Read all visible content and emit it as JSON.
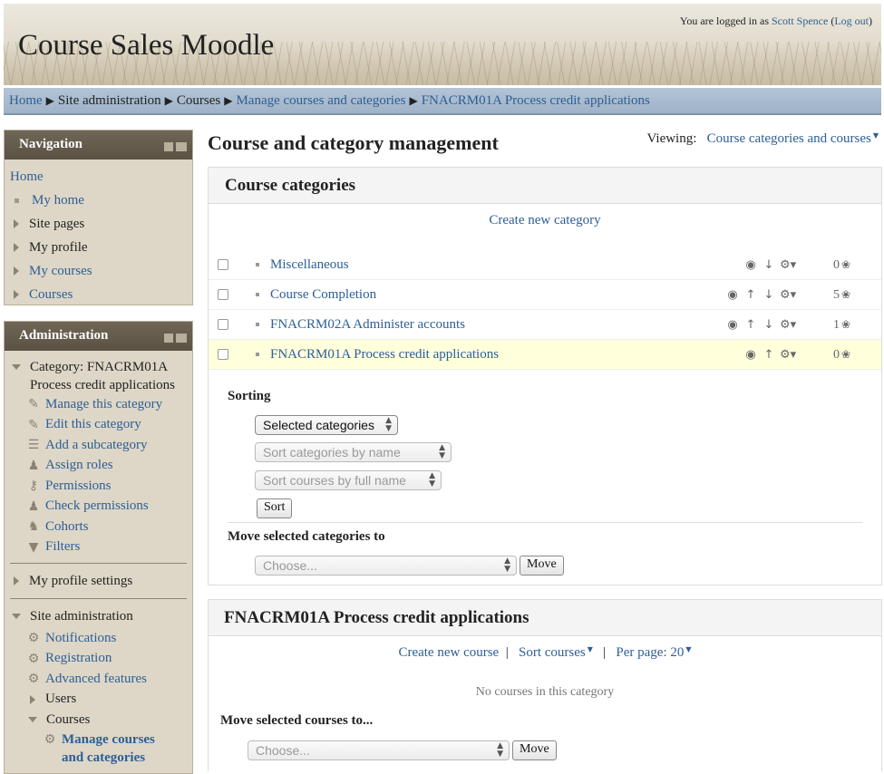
{
  "header": {
    "site_title": "Course Sales Moodle",
    "login_prefix": "You are logged in as",
    "user_name": "Scott Spence",
    "logout": "Log out"
  },
  "breadcrumb": [
    "Home",
    "Site administration",
    "Courses",
    "Manage courses and categories",
    "FNACRM01A Process credit applications"
  ],
  "navigation": {
    "title": "Navigation",
    "home": "Home",
    "items": [
      "My home",
      "Site pages",
      "My profile",
      "My courses",
      "Courses"
    ]
  },
  "administration": {
    "title": "Administration",
    "category_label": "Category: FNACRM01A Process credit applications",
    "category_items": [
      "Manage this category",
      "Edit this category",
      "Add a subcategory",
      "Assign roles",
      "Permissions",
      "Check permissions",
      "Cohorts",
      "Filters"
    ],
    "profile_settings": "My profile settings",
    "site_admin": "Site administration",
    "site_admin_items": [
      "Notifications",
      "Registration",
      "Advanced features"
    ],
    "users": "Users",
    "courses": "Courses",
    "manage": "Manage courses and categories"
  },
  "main": {
    "title": "Course and category management",
    "viewing_label": "Viewing:",
    "viewing_value": "Course categories and courses"
  },
  "categories_panel": {
    "title": "Course categories",
    "create_link": "Create new category",
    "rows": [
      {
        "name": "Miscellaneous",
        "count": "0"
      },
      {
        "name": "Course Completion",
        "count": "5"
      },
      {
        "name": "FNACRM02A Administer accounts",
        "count": "1"
      },
      {
        "name": "FNACRM01A Process credit applications",
        "count": "0"
      }
    ],
    "sorting_label": "Sorting",
    "sort_scope": "Selected categories",
    "sort_categories": "Sort categories by name",
    "sort_courses": "Sort courses by full name",
    "sort_button": "Sort",
    "move_label": "Move selected categories to",
    "move_placeholder": "Choose...",
    "move_button": "Move"
  },
  "courses_panel": {
    "title": "FNACRM01A Process credit applications",
    "create_course": "Create new course",
    "sort_courses": "Sort courses",
    "per_page": "Per page: 20",
    "empty": "No courses in this category",
    "move_label": "Move selected courses to...",
    "move_placeholder": "Choose...",
    "move_button": "Move"
  }
}
